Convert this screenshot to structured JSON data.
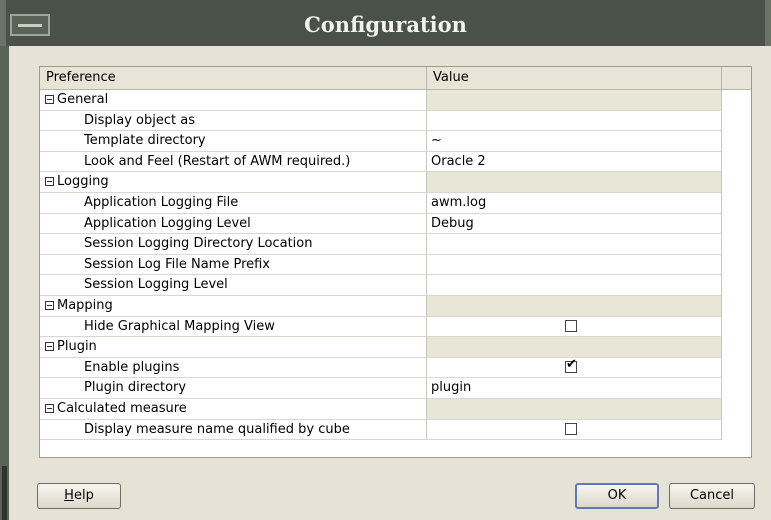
{
  "window": {
    "title": "Configuration"
  },
  "table": {
    "headers": {
      "preference": "Preference",
      "value": "Value"
    },
    "rows": [
      {
        "type": "group",
        "label": "General",
        "value": ""
      },
      {
        "type": "child",
        "label": "Display object as",
        "value": ""
      },
      {
        "type": "child",
        "label": "Template directory",
        "value": "~"
      },
      {
        "type": "child",
        "label": "Look and Feel (Restart of AWM required.)",
        "value": "Oracle 2"
      },
      {
        "type": "group",
        "label": "Logging",
        "value": ""
      },
      {
        "type": "child",
        "label": "Application Logging File",
        "value": "awm.log"
      },
      {
        "type": "child",
        "label": "Application Logging Level",
        "value": "Debug"
      },
      {
        "type": "child",
        "label": "Session Logging Directory Location",
        "value": ""
      },
      {
        "type": "child",
        "label": "Session Log File Name Prefix",
        "value": ""
      },
      {
        "type": "child",
        "label": "Session Logging Level",
        "value": ""
      },
      {
        "type": "group",
        "label": "Mapping",
        "value": ""
      },
      {
        "type": "child",
        "label": "Hide Graphical Mapping View",
        "checkbox": false
      },
      {
        "type": "group",
        "label": "Plugin",
        "value": ""
      },
      {
        "type": "child",
        "label": "Enable plugins",
        "checkbox": true
      },
      {
        "type": "child",
        "label": "Plugin directory",
        "value": "plugin"
      },
      {
        "type": "group",
        "label": "Calculated measure",
        "value": ""
      },
      {
        "type": "child",
        "label": "Display measure name qualified by cube",
        "checkbox": false
      }
    ]
  },
  "buttons": {
    "help": {
      "mnemonic": "H",
      "rest": "elp"
    },
    "ok": "OK",
    "cancel": "Cancel"
  }
}
